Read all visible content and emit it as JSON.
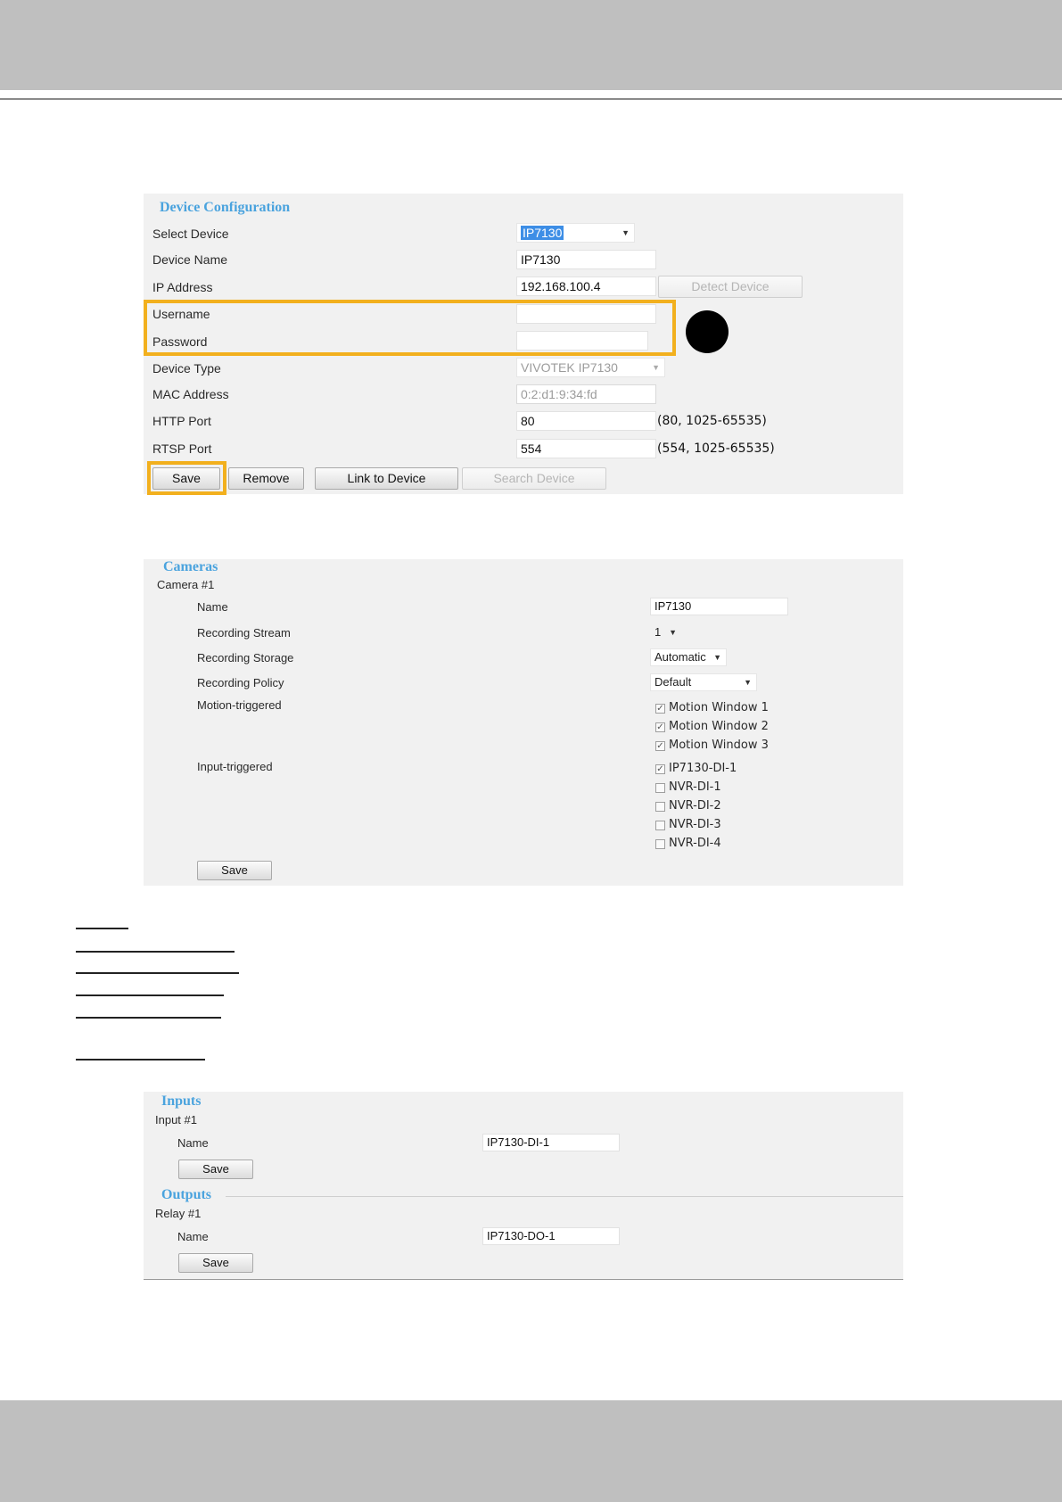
{
  "device_configuration": {
    "title": "Device Configuration",
    "select_device_label": "Select Device",
    "select_device_value": "IP7130",
    "device_name_label": "Device Name",
    "device_name_value": "IP7130",
    "ip_address_label": "IP Address",
    "ip_address_value": "192.168.100.4",
    "detect_device_button": "Detect Device",
    "username_label": "Username",
    "username_value": "",
    "password_label": "Password",
    "password_value": "",
    "device_type_label": "Device Type",
    "device_type_value": "VIVOTEK IP7130",
    "mac_address_label": "MAC Address",
    "mac_address_value": "0:2:d1:9:34:fd",
    "http_port_label": "HTTP Port",
    "http_port_value": "80",
    "http_port_hint": "(80, 1025-65535)",
    "rtsp_port_label": "RTSP Port",
    "rtsp_port_value": "554",
    "rtsp_port_hint": "(554, 1025-65535)",
    "save_button": "Save",
    "remove_button": "Remove",
    "link_button": "Link to Device",
    "search_button": "Search Device",
    "highlight_color": "#f2b01e"
  },
  "cameras": {
    "title": "Cameras",
    "camera_heading": "Camera #1",
    "name_label": "Name",
    "name_value": "IP7130",
    "recording_stream_label": "Recording Stream",
    "recording_stream_value": "1",
    "recording_storage_label": "Recording Storage",
    "recording_storage_value": "Automatic",
    "recording_policy_label": "Recording Policy",
    "recording_policy_value": "Default",
    "motion_label": "Motion-triggered",
    "motion_options": [
      {
        "label": "Motion Window 1",
        "checked": true
      },
      {
        "label": "Motion Window 2",
        "checked": true
      },
      {
        "label": "Motion Window 3",
        "checked": true
      }
    ],
    "input_label": "Input-triggered",
    "input_options": [
      {
        "label": "IP7130-DI-1",
        "checked": true
      },
      {
        "label": "NVR-DI-1",
        "checked": false
      },
      {
        "label": "NVR-DI-2",
        "checked": false
      },
      {
        "label": "NVR-DI-3",
        "checked": false
      },
      {
        "label": "NVR-DI-4",
        "checked": false
      }
    ],
    "save_button": "Save"
  },
  "io": {
    "inputs_title": "Inputs",
    "input_heading": "Input #1",
    "input_name_label": "Name",
    "input_name_value": "IP7130-DI-1",
    "input_save_button": "Save",
    "outputs_title": "Outputs",
    "relay_heading": "Relay #1",
    "relay_name_label": "Name",
    "relay_name_value": "IP7130-DO-1",
    "relay_save_button": "Save"
  },
  "colors": {
    "section_title": "#4aa3de",
    "panel_background": "#f1f1f1",
    "page_band": "#bfbfbf"
  }
}
